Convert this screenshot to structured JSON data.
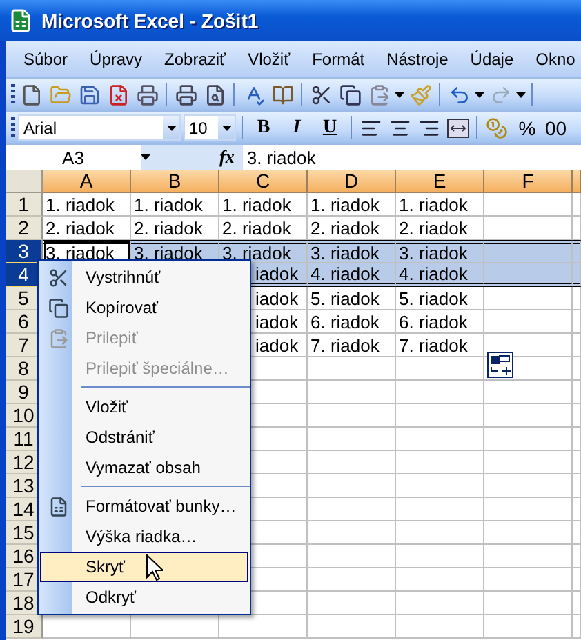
{
  "window": {
    "title": "Microsoft Excel - Zošit1"
  },
  "menu_bar": [
    "Súbor",
    "Úpravy",
    "Zobraziť",
    "Vložiť",
    "Formát",
    "Nástroje",
    "Údaje",
    "Okno"
  ],
  "formatting_toolbar": {
    "font": "Arial",
    "size": "10",
    "styles": [
      "B",
      "I",
      "U"
    ],
    "percent": "%",
    "comma": "00"
  },
  "formula_bar": {
    "name_box": "A3",
    "fx": "fx",
    "value": "3. riadok"
  },
  "columns": [
    {
      "label": "A",
      "selected": true
    },
    {
      "label": "B",
      "selected": true
    },
    {
      "label": "C",
      "selected": true
    },
    {
      "label": "D",
      "selected": true
    },
    {
      "label": "E",
      "selected": true
    },
    {
      "label": "F",
      "selected": true
    }
  ],
  "rows": [
    {
      "label": "1",
      "selected": false,
      "cells": [
        {
          "kind": "plain",
          "text": "1. riadok"
        },
        {
          "kind": "plain",
          "text": "1. riadok"
        },
        {
          "kind": "plain",
          "text": "1. riadok"
        },
        {
          "kind": "plain",
          "text": "1. riadok"
        },
        {
          "kind": "plain",
          "text": "1. riadok"
        }
      ]
    },
    {
      "label": "2",
      "selected": false,
      "cells": [
        {
          "kind": "plain",
          "text": "2. riadok"
        },
        {
          "kind": "plain",
          "text": "2. riadok"
        },
        {
          "kind": "plain",
          "text": "2. riadok"
        },
        {
          "kind": "plain",
          "text": "2. riadok"
        },
        {
          "kind": "plain",
          "text": "2. riadok"
        }
      ]
    },
    {
      "label": "3",
      "selected": true,
      "cells": [
        {
          "kind": "active",
          "text": "3. riadok"
        },
        {
          "kind": "plain",
          "text": "3. riadok"
        },
        {
          "kind": "plain",
          "text": "3. riadok"
        },
        {
          "kind": "plain",
          "text": "3. riadok"
        },
        {
          "kind": "plain",
          "text": "3. riadok"
        }
      ]
    },
    {
      "label": "4",
      "selected": true,
      "cells": [
        {
          "kind": "covered"
        },
        {
          "kind": "covered"
        },
        {
          "kind": "clipped",
          "text": "iadok"
        },
        {
          "kind": "plain",
          "text": "4. riadok"
        },
        {
          "kind": "plain",
          "text": "4. riadok"
        }
      ]
    },
    {
      "label": "5",
      "selected": false,
      "cells": [
        {
          "kind": "covered"
        },
        {
          "kind": "covered"
        },
        {
          "kind": "clipped",
          "text": "iadok"
        },
        {
          "kind": "plain",
          "text": "5. riadok"
        },
        {
          "kind": "plain",
          "text": "5. riadok"
        }
      ]
    },
    {
      "label": "6",
      "selected": false,
      "cells": [
        {
          "kind": "covered"
        },
        {
          "kind": "covered"
        },
        {
          "kind": "clipped",
          "text": "iadok"
        },
        {
          "kind": "plain",
          "text": "6. riadok"
        },
        {
          "kind": "plain",
          "text": "6. riadok"
        }
      ]
    },
    {
      "label": "7",
      "selected": false,
      "cells": [
        {
          "kind": "covered"
        },
        {
          "kind": "covered"
        },
        {
          "kind": "clipped",
          "text": "iadok"
        },
        {
          "kind": "plain",
          "text": "7. riadok"
        },
        {
          "kind": "plain",
          "text": "7. riadok"
        }
      ]
    },
    {
      "label": "8",
      "selected": false
    },
    {
      "label": "9",
      "selected": false
    },
    {
      "label": "10",
      "selected": false
    },
    {
      "label": "11",
      "selected": false
    },
    {
      "label": "12",
      "selected": false
    },
    {
      "label": "13",
      "selected": false
    },
    {
      "label": "14",
      "selected": false
    },
    {
      "label": "15",
      "selected": false
    },
    {
      "label": "16",
      "selected": false
    },
    {
      "label": "17",
      "selected": false
    },
    {
      "label": "18",
      "selected": false
    },
    {
      "label": "19",
      "selected": false
    }
  ],
  "context_menu": [
    {
      "kind": "item",
      "label": "Vystrihnúť",
      "disabled": false,
      "selected": false
    },
    {
      "kind": "item",
      "label": "Kopírovať",
      "disabled": false,
      "selected": false
    },
    {
      "kind": "item",
      "label": "Prilepiť",
      "disabled": true,
      "selected": false
    },
    {
      "kind": "item",
      "label": "Prilepiť špeciálne…",
      "disabled": true,
      "selected": false
    },
    {
      "kind": "separator"
    },
    {
      "kind": "item",
      "label": "Vložiť",
      "disabled": false,
      "selected": false
    },
    {
      "kind": "item",
      "label": "Odstrániť",
      "disabled": false,
      "selected": false
    },
    {
      "kind": "item",
      "label": "Vymazať obsah",
      "disabled": false,
      "selected": false
    },
    {
      "kind": "separator"
    },
    {
      "kind": "item",
      "label": "Formátovať bunky…",
      "disabled": false,
      "selected": false
    },
    {
      "kind": "item",
      "label": "Výška riadka…",
      "disabled": false,
      "selected": false
    },
    {
      "kind": "item",
      "label": "Skryť",
      "disabled": false,
      "selected": true
    },
    {
      "kind": "item",
      "label": "Odkryť",
      "disabled": false,
      "selected": false
    }
  ]
}
